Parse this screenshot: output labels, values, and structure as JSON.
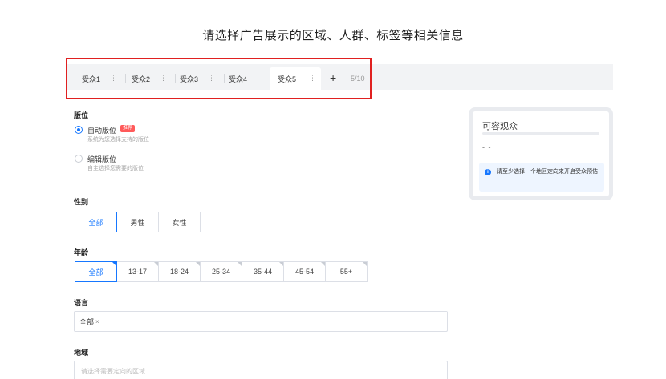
{
  "heading": "请选择广告展示的区域、人群、标签等相关信息",
  "tabs": [
    {
      "label": "受众1",
      "menu": "⋮"
    },
    {
      "label": "受众2",
      "menu": "⋮"
    },
    {
      "label": "受众3",
      "menu": "⋮"
    },
    {
      "label": "受众4",
      "menu": "⋮"
    },
    {
      "label": "受众5",
      "menu": "⋮"
    }
  ],
  "tabs_active_index": 4,
  "tabs_add": "+",
  "tabs_count": "5/10",
  "placement": {
    "label": "版位",
    "options": [
      {
        "title": "自动版位",
        "desc": "系统为您选择支持的版位",
        "checked": true,
        "badge": "推荐"
      },
      {
        "title": "编辑版位",
        "desc": "自主选择您需要的版位",
        "checked": false
      }
    ]
  },
  "gender": {
    "label": "性别",
    "options": [
      "全部",
      "男性",
      "女性"
    ],
    "selected": "全部"
  },
  "age": {
    "label": "年龄",
    "options": [
      "全部",
      "13-17",
      "18-24",
      "25-34",
      "35-44",
      "45-54",
      "55+"
    ],
    "selected": "全部"
  },
  "language": {
    "label": "语言",
    "tag": "全部",
    "tag_close": "×"
  },
  "region": {
    "label": "地域",
    "placeholder": "请选择需要定向的区域"
  },
  "audience_card": {
    "title": "可容观众",
    "value": "- -",
    "note": "请至少选择一个地区定向来开启受众预估",
    "info_icon": "i"
  },
  "colors": {
    "accent": "#1677ff",
    "highlight": "#e02020",
    "badge": "#ff5a5a"
  }
}
